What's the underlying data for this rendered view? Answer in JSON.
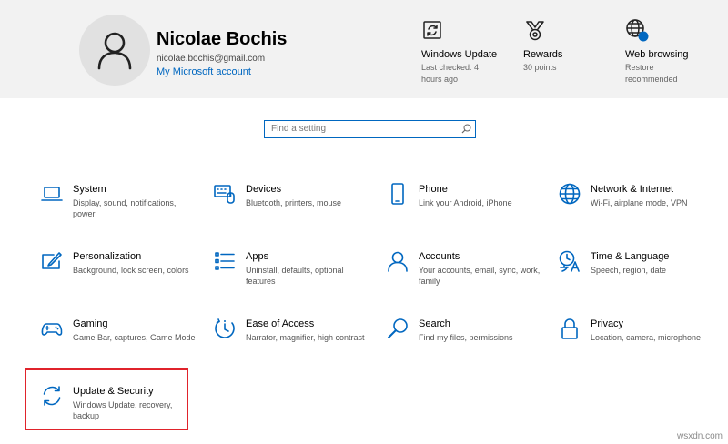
{
  "header": {
    "user_name": "Nicolae Bochis",
    "user_email": "nicolae.bochis@gmail.com",
    "account_link": "My Microsoft account",
    "cards": [
      {
        "title": "Windows Update",
        "sub": "Last checked: 4 hours ago",
        "icon": "windows-update-icon"
      },
      {
        "title": "Rewards",
        "sub": "30 points",
        "icon": "rewards-icon"
      },
      {
        "title": "Web browsing",
        "sub": "Restore recommended",
        "icon": "web-browsing-icon"
      }
    ]
  },
  "search": {
    "placeholder": "Find a setting"
  },
  "tiles": [
    {
      "title": "System",
      "desc": "Display, sound, notifications, power",
      "icon": "laptop-icon"
    },
    {
      "title": "Devices",
      "desc": "Bluetooth, printers, mouse",
      "icon": "keyboard-icon"
    },
    {
      "title": "Phone",
      "desc": "Link your Android, iPhone",
      "icon": "phone-icon"
    },
    {
      "title": "Network & Internet",
      "desc": "Wi-Fi, airplane mode, VPN",
      "icon": "globe-icon"
    },
    {
      "title": "Personalization",
      "desc": "Background, lock screen, colors",
      "icon": "pen-tablet-icon"
    },
    {
      "title": "Apps",
      "desc": "Uninstall, defaults, optional features",
      "icon": "apps-list-icon"
    },
    {
      "title": "Accounts",
      "desc": "Your accounts, email, sync, work, family",
      "icon": "person-icon"
    },
    {
      "title": "Time & Language",
      "desc": "Speech, region, date",
      "icon": "time-language-icon"
    },
    {
      "title": "Gaming",
      "desc": "Game Bar, captures, Game Mode",
      "icon": "gamepad-icon"
    },
    {
      "title": "Ease of Access",
      "desc": "Narrator, magnifier, high contrast",
      "icon": "ease-of-access-icon"
    },
    {
      "title": "Search",
      "desc": "Find my files, permissions",
      "icon": "magnifier-icon"
    },
    {
      "title": "Privacy",
      "desc": "Location, camera, microphone",
      "icon": "lock-icon"
    },
    {
      "title": "Update & Security",
      "desc": "Windows Update, recovery, backup",
      "icon": "sync-arrows-icon"
    }
  ],
  "watermark": "wsxdn.com",
  "colors": {
    "accent": "#0067c0",
    "highlight": "#e0232b",
    "header_bg": "#f2f2f2"
  }
}
